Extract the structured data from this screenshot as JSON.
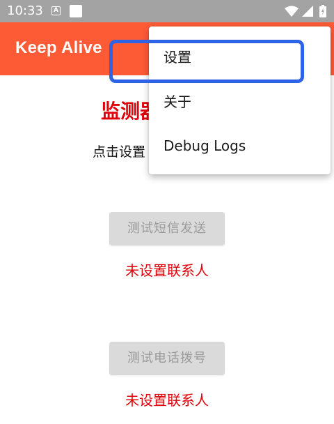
{
  "status_bar": {
    "time": "10:33",
    "notification_letter": "A",
    "icons": [
      "a-notification-icon",
      "square-notification-icon",
      "wifi-icon",
      "cellular-signal-icon",
      "battery-icon"
    ]
  },
  "app_bar": {
    "title": "Keep Alive",
    "color": "#fd5a36"
  },
  "main": {
    "headline": "监测器",
    "hint": "点击设置",
    "sms_test_button": "测试短信发送",
    "sms_status": "未设置联系人",
    "call_test_button": "测试电话拨号",
    "call_status": "未设置联系人",
    "status_color": "#e0000a"
  },
  "menu": {
    "items": [
      {
        "label": "设置"
      },
      {
        "label": "关于"
      },
      {
        "label": "Debug Logs"
      }
    ]
  },
  "highlight": {
    "target": "设置",
    "color": "#2e63e8"
  }
}
